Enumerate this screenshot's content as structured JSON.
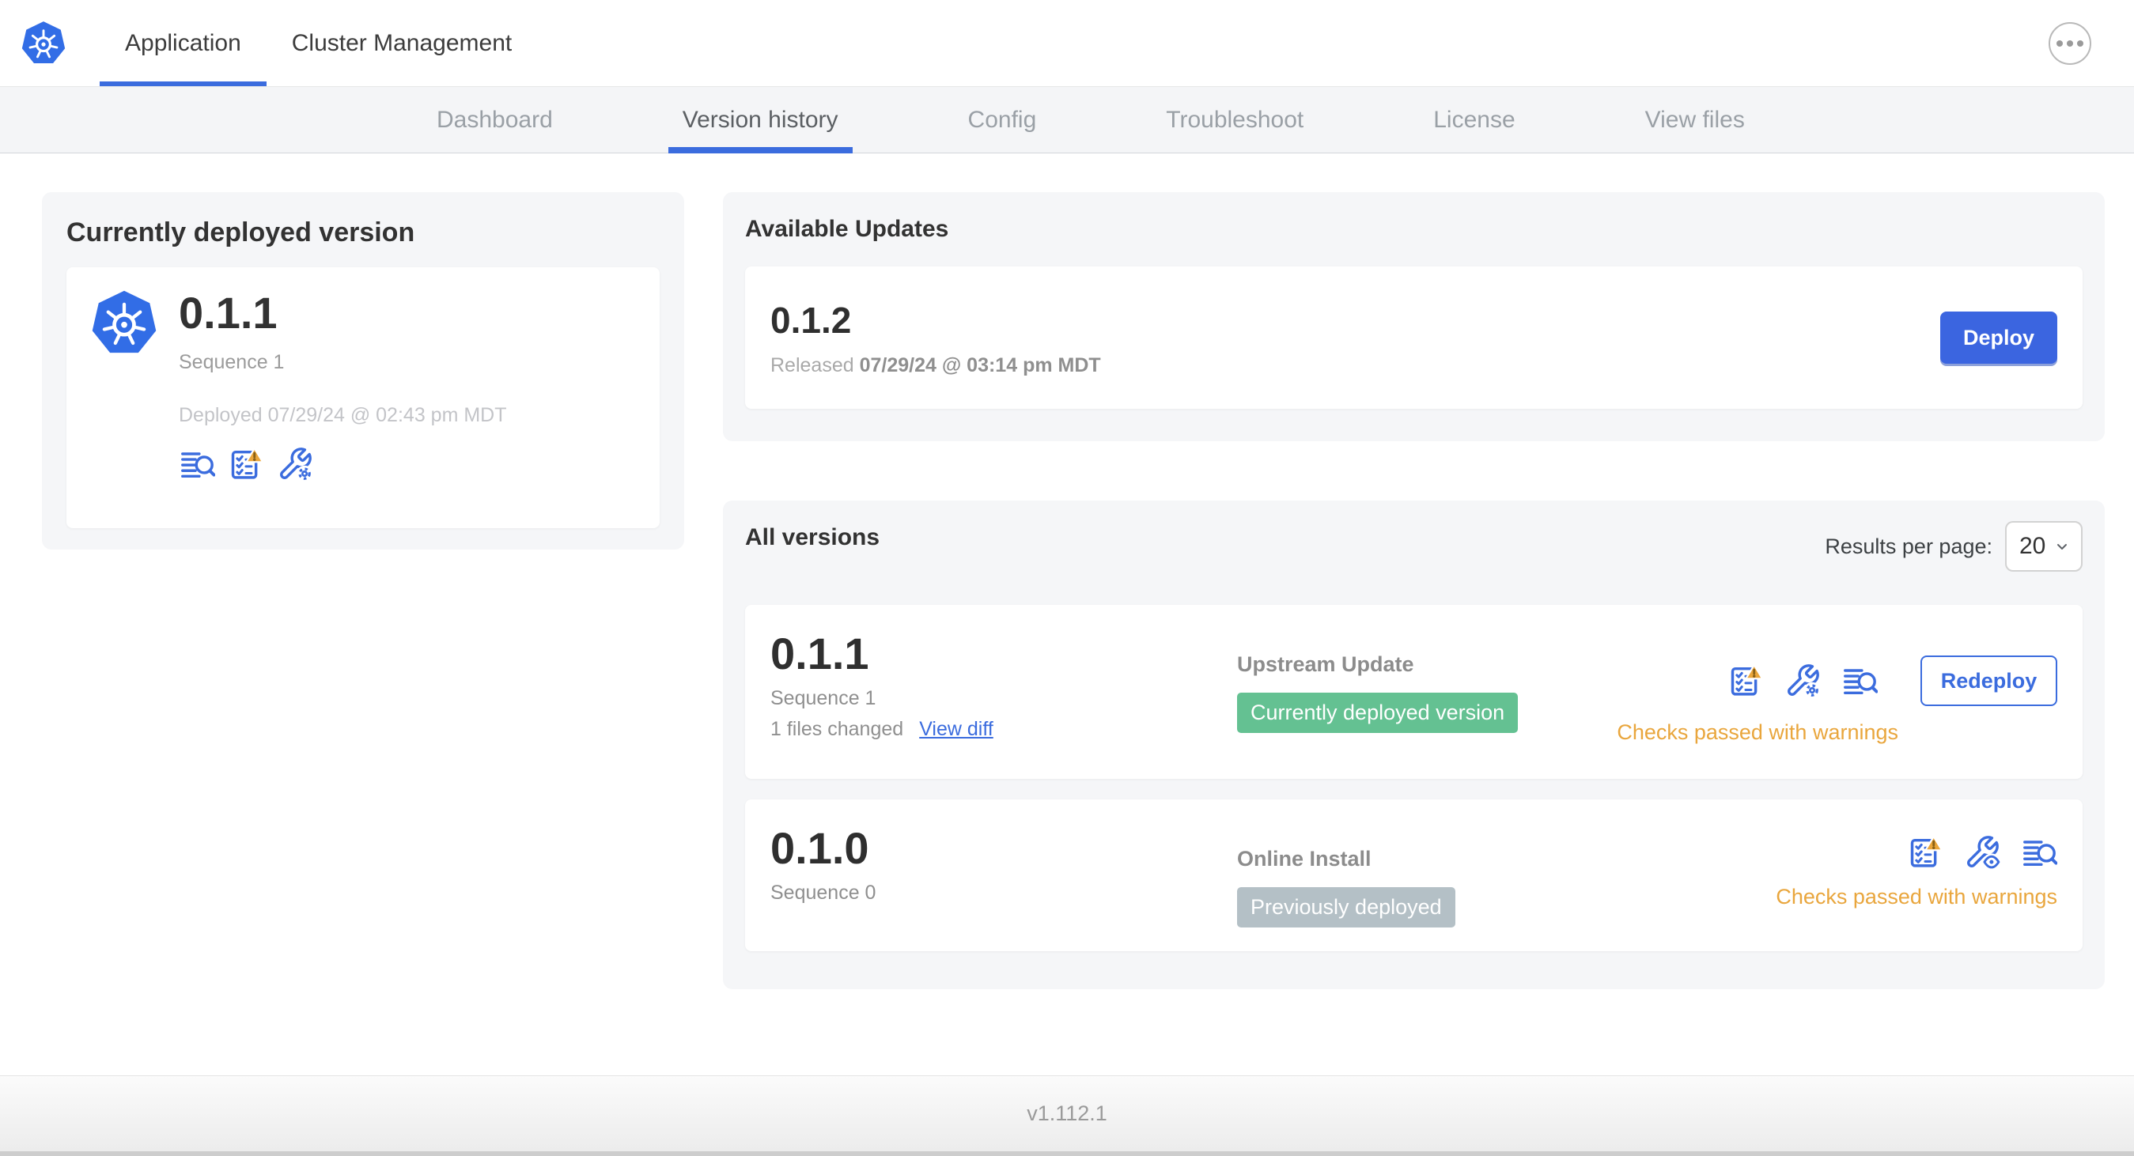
{
  "topbar": {
    "tabs": [
      {
        "label": "Application",
        "active": true
      },
      {
        "label": "Cluster Management",
        "active": false
      }
    ],
    "menu_icon": "ellipsis-icon"
  },
  "subnav": {
    "tabs": [
      {
        "label": "Dashboard"
      },
      {
        "label": "Version history"
      },
      {
        "label": "Config"
      },
      {
        "label": "Troubleshoot"
      },
      {
        "label": "License"
      },
      {
        "label": "View files"
      }
    ],
    "active_tab": "Version history"
  },
  "current_version": {
    "title": "Currently deployed version",
    "version": "0.1.1",
    "sequence": "Sequence 1",
    "deployed": "Deployed 07/29/24 @ 02:43 pm MDT",
    "icons": [
      "logs-icon",
      "preflight-checks-warning-icon",
      "config-edit-icon"
    ]
  },
  "available_updates": {
    "title": "Available Updates",
    "version": "0.1.2",
    "released_label": "Released",
    "released_date": "07/29/24 @ 03:14 pm MDT",
    "deploy_label": "Deploy"
  },
  "all_versions": {
    "title": "All versions",
    "results_per_page_label": "Results per page:",
    "results_per_page_value": "20",
    "rows": [
      {
        "version": "0.1.1",
        "sequence": "Sequence 1",
        "files_changed": "1 files changed",
        "view_diff_label": "View diff",
        "source": "Upstream Update",
        "badge": "Currently deployed version",
        "badge_color": "#64C192",
        "icons": [
          "preflight-checks-warning-icon",
          "config-edit-icon",
          "logs-icon"
        ],
        "action_label": "Redeploy",
        "status": "Checks passed with warnings"
      },
      {
        "version": "0.1.0",
        "sequence": "Sequence 0",
        "source": "Online Install",
        "badge": "Previously deployed",
        "badge_color": "#B4C0C6",
        "icons": [
          "preflight-checks-warning-icon",
          "config-view-icon",
          "logs-icon"
        ],
        "status": "Checks passed with warnings"
      }
    ]
  },
  "footer": {
    "version": "v1.112.1"
  },
  "colors": {
    "accent_blue": "#3B6CDE",
    "deploy_button_blue": "#3B65E0",
    "kubernetes_blue": "#326DE6",
    "badge_green": "#64C192",
    "badge_gray": "#B4C0C6",
    "warning_amber": "#E9A63D",
    "card_gray": "#F5F6F8"
  }
}
